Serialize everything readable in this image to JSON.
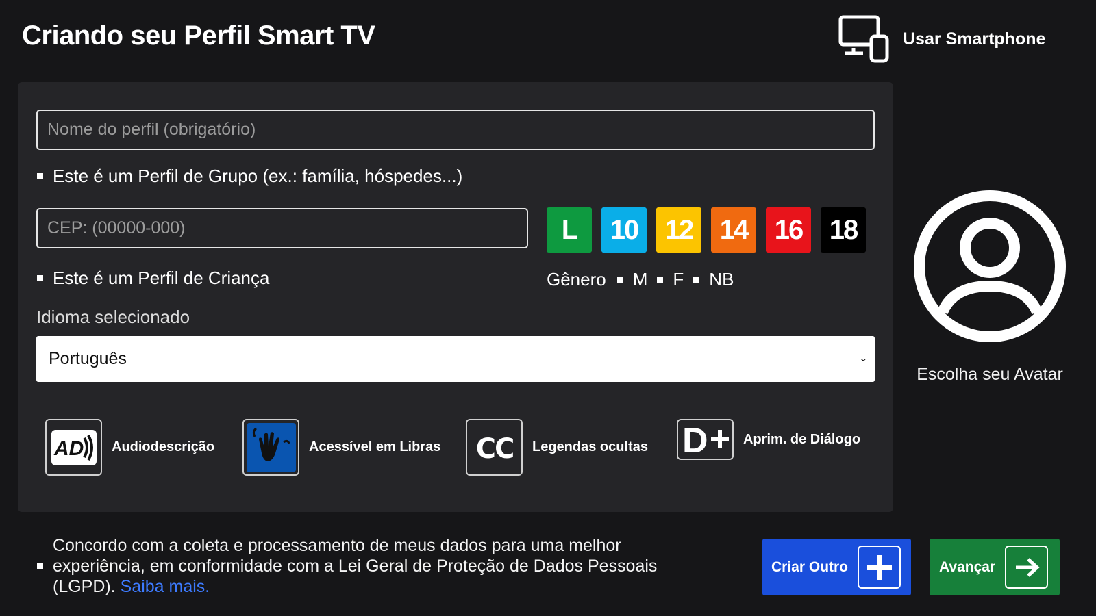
{
  "header": {
    "title": "Criando seu Perfil Smart TV",
    "smartphone_label": "Usar Smartphone",
    "smartphone_icon": "devices-icon"
  },
  "form": {
    "name_placeholder": "Nome do perfil (obrigatório)",
    "name_value": "",
    "group_profile_label": "Este é um Perfil de Grupo (ex.: família, hóspedes...)",
    "cep_placeholder": "CEP: (00000-000)",
    "cep_value": "",
    "child_profile_label": "Este é um Perfil de Criança",
    "ratings": [
      {
        "label": "L",
        "color": "#0e9a40"
      },
      {
        "label": "10",
        "color": "#0aaee8"
      },
      {
        "label": "12",
        "color": "#fcc400"
      },
      {
        "label": "14",
        "color": "#f06a10"
      },
      {
        "label": "16",
        "color": "#e8141b"
      },
      {
        "label": "18",
        "color": "#000000"
      }
    ],
    "gender": {
      "label": "Gênero",
      "options": [
        "M",
        "F",
        "NB"
      ]
    },
    "language": {
      "label": "Idioma selecionado",
      "selected": "Português"
    }
  },
  "accessibility": [
    {
      "label": "Audiodescrição",
      "icon": "audio-description-icon"
    },
    {
      "label": "Acessível em Libras",
      "icon": "sign-language-icon"
    },
    {
      "label": "Legendas ocultas",
      "icon": "closed-captions-icon"
    },
    {
      "label": "Aprim. de Diálogo",
      "icon": "dialogue-enhancement-icon"
    }
  ],
  "avatar": {
    "label": "Escolha seu Avatar",
    "icon": "user-circle-icon"
  },
  "consent": {
    "text": "Concordo com a coleta e processamento de meus dados para uma melhor experiência, em conformidade com a Lei Geral de Proteção de Dados Pessoais (LGPD).",
    "link": "Saiba mais."
  },
  "actions": {
    "create_another": "Criar Outro",
    "next": "Avançar"
  },
  "colors": {
    "background": "#161618",
    "panel": "#252528",
    "create_button": "#1a4fdc",
    "next_button": "#17803a",
    "link": "#3d7bff",
    "libras_blue": "#0a55b0"
  }
}
